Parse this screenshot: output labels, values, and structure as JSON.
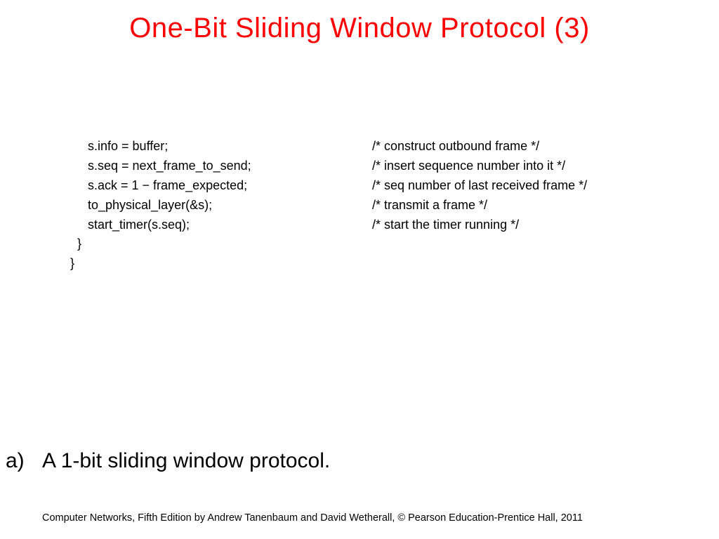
{
  "title": "One-Bit Sliding Window Protocol (3)",
  "code": {
    "lines": [
      {
        "stmt": "     s.info = buffer;",
        "comment": "/* construct outbound frame */"
      },
      {
        "stmt": "     s.seq = next_frame_to_send;",
        "comment": "/* insert sequence number into it */"
      },
      {
        "stmt": "     s.ack = 1 − frame_expected;",
        "comment": "/* seq number of last received frame */"
      },
      {
        "stmt": "     to_physical_layer(&s);",
        "comment": "/* transmit a frame */"
      },
      {
        "stmt": "     start_timer(s.seq);",
        "comment": "/* start the timer running */"
      }
    ],
    "close1": "  }",
    "close2": "}"
  },
  "caption": {
    "label": "a)",
    "text": "A 1-bit sliding window protocol."
  },
  "footer": "Computer Networks, Fifth Edition by Andrew Tanenbaum and David Wetherall, © Pearson Education-Prentice Hall, 2011"
}
